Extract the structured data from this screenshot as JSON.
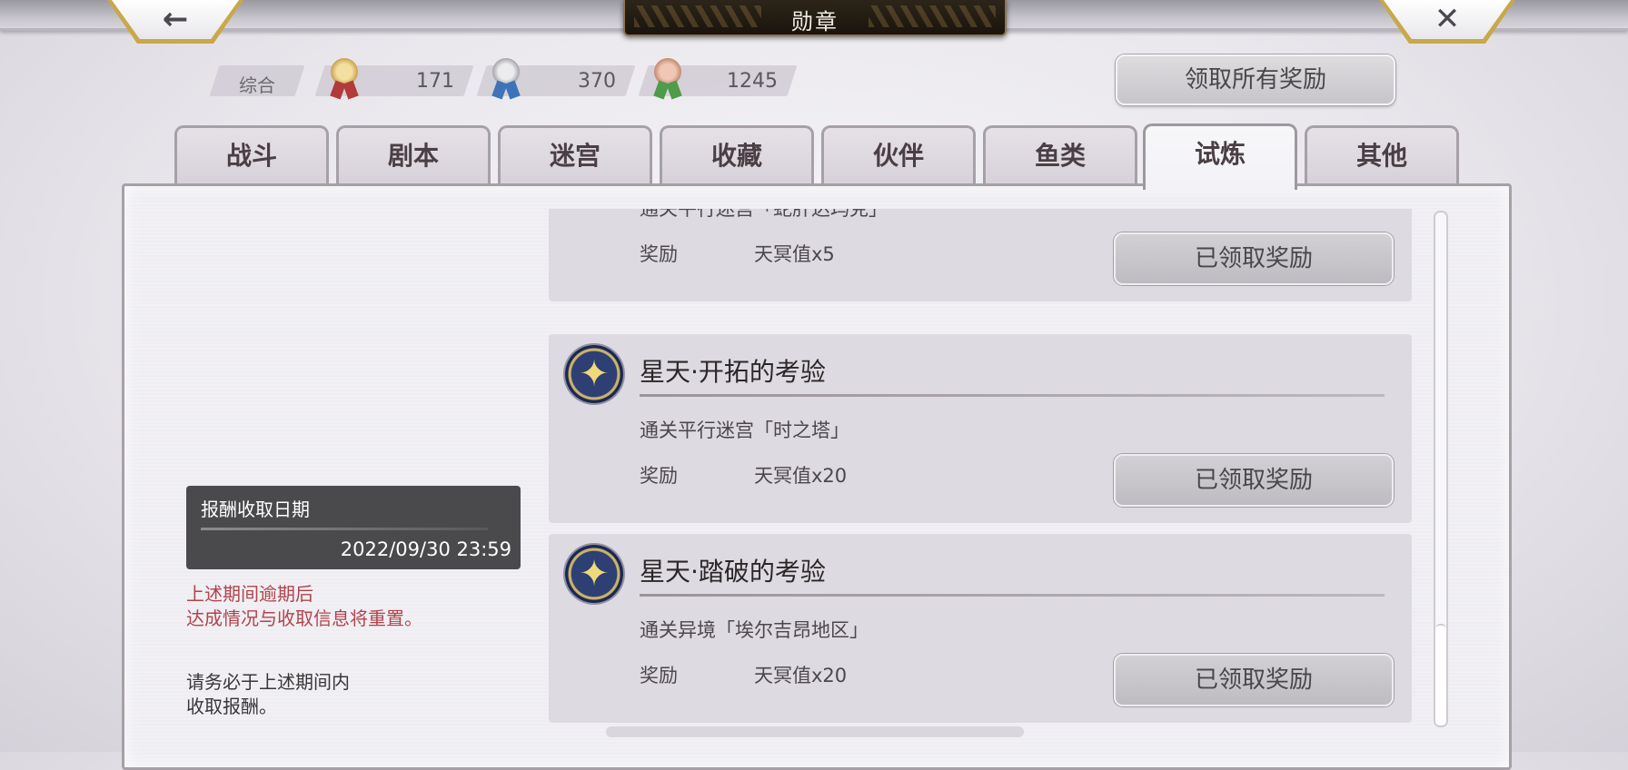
{
  "header": {
    "title": "勋章",
    "back_glyph": "←",
    "close_glyph": "✕"
  },
  "stats": {
    "overall_label": "综合",
    "gold": "171",
    "silver": "370",
    "bronze": "1245"
  },
  "claim_all_label": "领取所有奖励",
  "tabs": [
    "战斗",
    "剧本",
    "迷宫",
    "收藏",
    "伙伴",
    "鱼类",
    "试炼",
    "其他"
  ],
  "active_tab": "试炼",
  "reward_period": {
    "header": "报酬收取日期",
    "date": "2022/09/30 23:59",
    "warning_line1": "上述期间逾期后",
    "warning_line2": "达成情况与收取信息将重置。",
    "note_line1": "请务必于上述期间内",
    "note_line2": "收取报酬。"
  },
  "achievements": [
    {
      "title": "",
      "description": "通关平行迷宫「蛇肝达玛克」",
      "reward_label": "奖励",
      "reward_value": "天冥值x5",
      "button_label": "已领取奖励"
    },
    {
      "title": "星天·开拓的考验",
      "description": "通关平行迷宫「时之塔」",
      "reward_label": "奖励",
      "reward_value": "天冥值x20",
      "button_label": "已领取奖励"
    },
    {
      "title": "星天·踏破的考验",
      "description": "通关异境「埃尔吉昂地区」",
      "reward_label": "奖励",
      "reward_value": "天冥值x20",
      "button_label": "已领取奖励"
    }
  ],
  "colors": {
    "warning_text": "#b0444c",
    "gold_medal": "#d8b565",
    "silver_medal": "#a9a9ad",
    "bronze_medal": "#c28a72"
  }
}
